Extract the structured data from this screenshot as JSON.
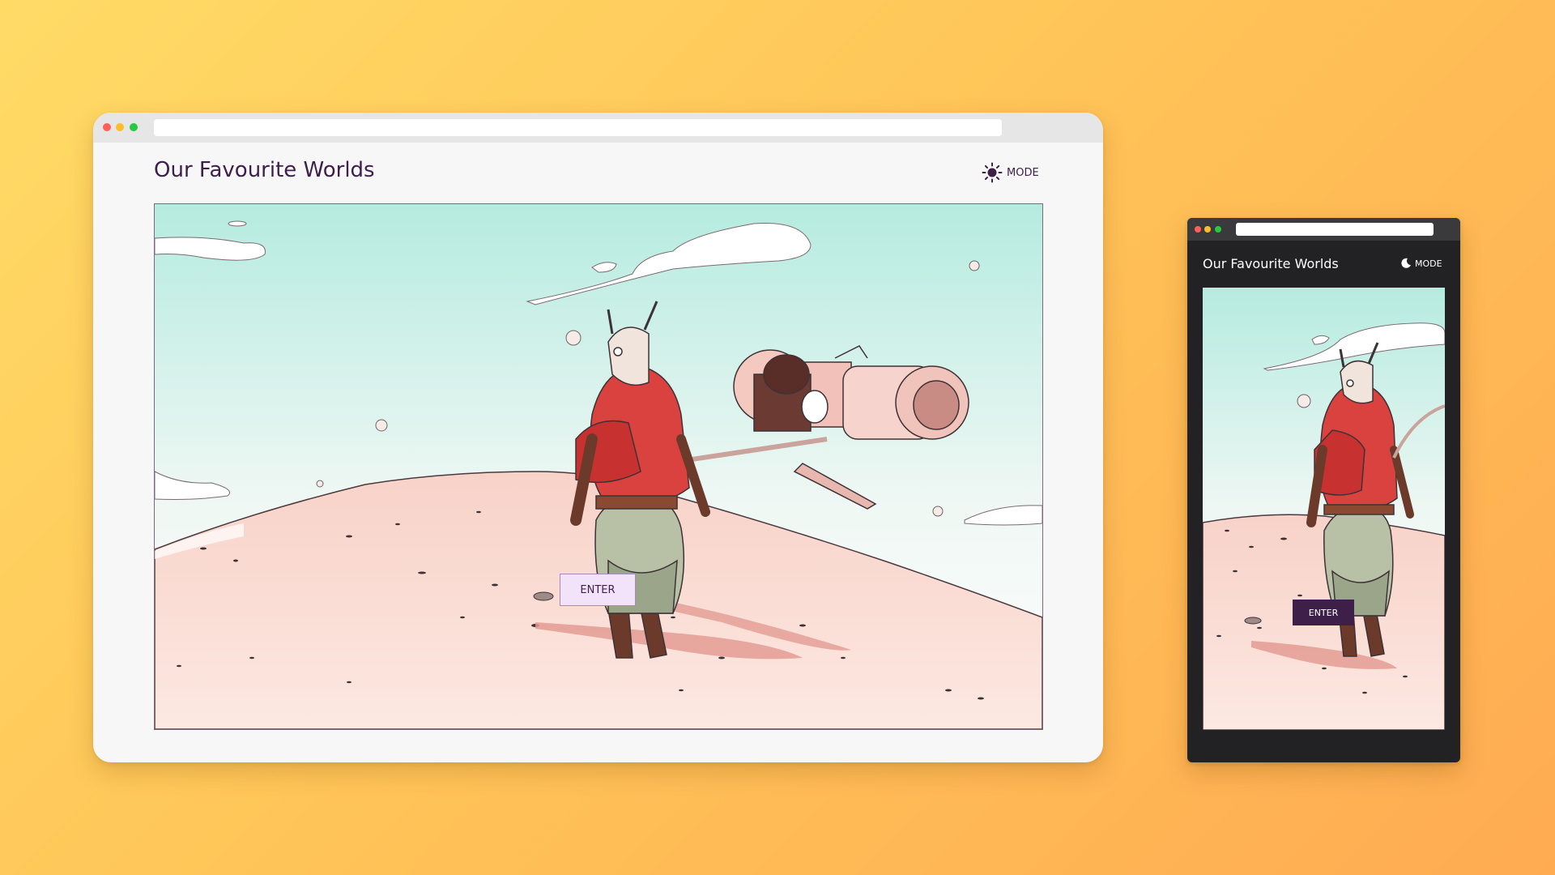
{
  "colors": {
    "accent": "#3d1f4a",
    "light_button_bg": "#f3e3fa",
    "dark_bg": "#222224",
    "dot_red": "#ff5f57",
    "dot_yellow": "#febc2e",
    "dot_green": "#28c840"
  },
  "desktop": {
    "title": "Our Favourite Worlds",
    "mode_label": "MODE",
    "mode_icon": "sun-icon",
    "enter_label": "ENTER",
    "theme": "light"
  },
  "mobile": {
    "title": "Our Favourite Worlds",
    "mode_label": "MODE",
    "mode_icon": "moon-icon",
    "enter_label": "ENTER",
    "theme": "dark"
  }
}
